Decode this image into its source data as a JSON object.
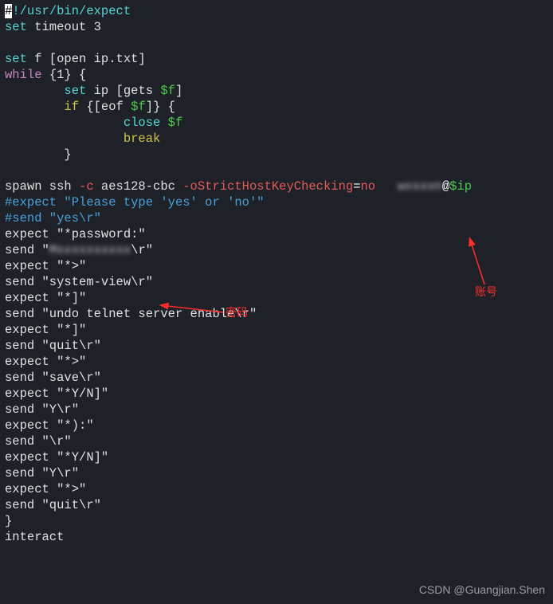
{
  "code": {
    "shebang_hash": "#",
    "shebang_rest": "!/usr/bin/expect",
    "l2_set": "set",
    "l2_rest": " timeout 3",
    "l4_set": "set",
    "l4_rest": " f [open ip.txt]",
    "l5_while": "while",
    "l5_rest": " {1} {",
    "l6_indent": "        ",
    "l6_set": "set",
    "l6_rest": " ip [gets ",
    "l6_var": "$f",
    "l6_close": "]",
    "l7_indent": "        ",
    "l7_if": "if",
    "l7_a": " {[eof ",
    "l7_var": "$f",
    "l7_b": "]} {",
    "l8_indent": "                ",
    "l8_cmd": "close",
    "l8_sp": " ",
    "l8_var": "$f",
    "l9_indent": "                ",
    "l9_break": "break",
    "l10": "        }",
    "l12_spawn": "spawn ssh ",
    "l12_flag1": "-c",
    "l12_mid": " aes128-cbc ",
    "l12_flag2": "-oStrictHostKeyChecking",
    "l12_eq": "=",
    "l12_no": "no",
    "l12_sp": "   ",
    "l12_user": "wxxxxn",
    "l12_at": "@",
    "l12_var": "$ip",
    "l13_a": "#expect \"Please type ",
    "l13_yes": "'yes'",
    "l13_b": " or ",
    "l13_no": "'no'",
    "l13_c": "\"",
    "l14": "#send \"yes\\r\"",
    "l15": "expect \"*password:\"",
    "l16_a": "send \"",
    "l16_pw": "Mxxxxxxxxxx",
    "l16_b": "\\r\"",
    "l17": "expect \"*>\"",
    "l18": "send \"system-view\\r\"",
    "l19": "expect \"*]\"",
    "l20": "send \"undo telnet server enable\\r\"",
    "l21": "expect \"*]\"",
    "l22": "send \"quit\\r\"",
    "l23": "expect \"*>\"",
    "l24": "send \"save\\r\"",
    "l25": "expect \"*Y/N]\"",
    "l26": "send \"Y\\r\"",
    "l27": "expect \"*):\"",
    "l28": "send \"\\r\"",
    "l29": "expect \"*Y/N]\"",
    "l30": "send \"Y\\r\"",
    "l31": "expect \"*>\"",
    "l32": "send \"quit\\r\"",
    "l33": "}",
    "l34": "interact"
  },
  "annotations": {
    "password_label": "密码",
    "account_label": "账号"
  },
  "watermark": "CSDN @Guangjian.Shen"
}
